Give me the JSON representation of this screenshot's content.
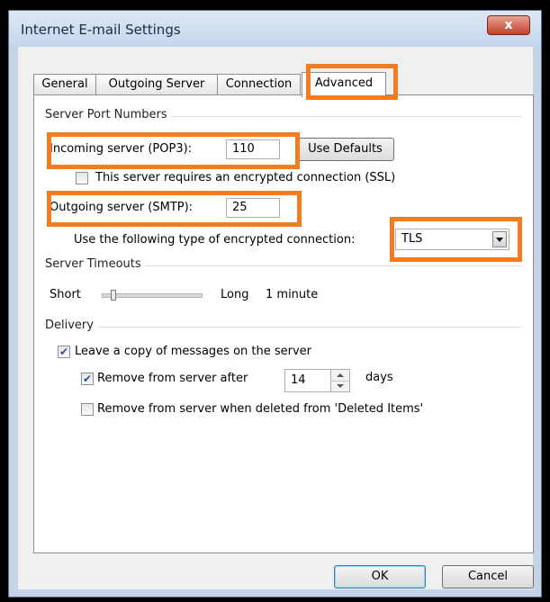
{
  "window": {
    "title": "Internet E-mail Settings",
    "close_glyph": "x"
  },
  "tabs": [
    {
      "label": "General"
    },
    {
      "label": "Outgoing Server"
    },
    {
      "label": "Connection"
    },
    {
      "label": "Advanced"
    }
  ],
  "server_ports": {
    "group_title": "Server Port Numbers",
    "incoming_label": "Incoming server (POP3):",
    "incoming_value": "110",
    "use_defaults_label": "Use Defaults",
    "ssl_label": "This server requires an encrypted connection (SSL)",
    "ssl_checked": false,
    "outgoing_label": "Outgoing server (SMTP):",
    "outgoing_value": "25",
    "encryption_label": "Use the following type of encrypted connection:",
    "encryption_value": "TLS"
  },
  "timeouts": {
    "group_title": "Server Timeouts",
    "short_label": "Short",
    "long_label": "Long",
    "value_label": "1 minute"
  },
  "delivery": {
    "group_title": "Delivery",
    "leave_copy_label": "Leave a copy of messages on the server",
    "leave_copy_checked": true,
    "remove_after_label": "Remove from server after",
    "remove_after_checked": true,
    "remove_after_days": "14",
    "days_label": "days",
    "remove_deleted_label": "Remove from server when deleted from 'Deleted Items'",
    "remove_deleted_checked": false
  },
  "footer": {
    "ok_label": "OK",
    "cancel_label": "Cancel"
  },
  "colors": {
    "highlight": "#f47b20"
  }
}
